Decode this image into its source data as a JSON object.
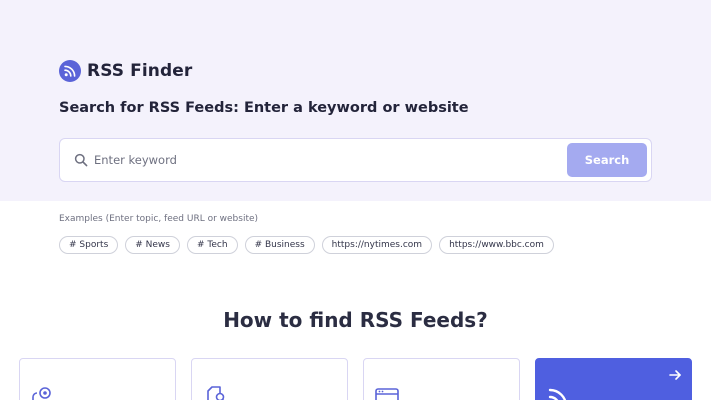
{
  "brand": {
    "name": "RSS Finder",
    "logo_icon": "rss-icon"
  },
  "hero": {
    "headline": "Search for RSS Feeds: Enter a keyword or website",
    "background": "#f4f2fc"
  },
  "search": {
    "placeholder": "Enter keyword",
    "value": "",
    "button_label": "Search",
    "icon": "search-icon"
  },
  "examples": {
    "label": "Examples (Enter topic, feed URL or website)",
    "chips": [
      "# Sports",
      "# News",
      "# Tech",
      "# Business",
      "https://nytimes.com",
      "https://www.bbc.com"
    ]
  },
  "how_to": {
    "title": "How to find RSS Feeds?",
    "cards": [
      {
        "icon": "target-search-icon",
        "active": false
      },
      {
        "icon": "document-search-icon",
        "active": false
      },
      {
        "icon": "browser-window-icon",
        "active": false
      },
      {
        "icon": "rss-icon",
        "active": true,
        "arrow": "arrow-right-icon"
      }
    ]
  },
  "colors": {
    "accent": "#5a63d8",
    "button": "#a4aaf0",
    "active_card": "#4f5fe0"
  }
}
